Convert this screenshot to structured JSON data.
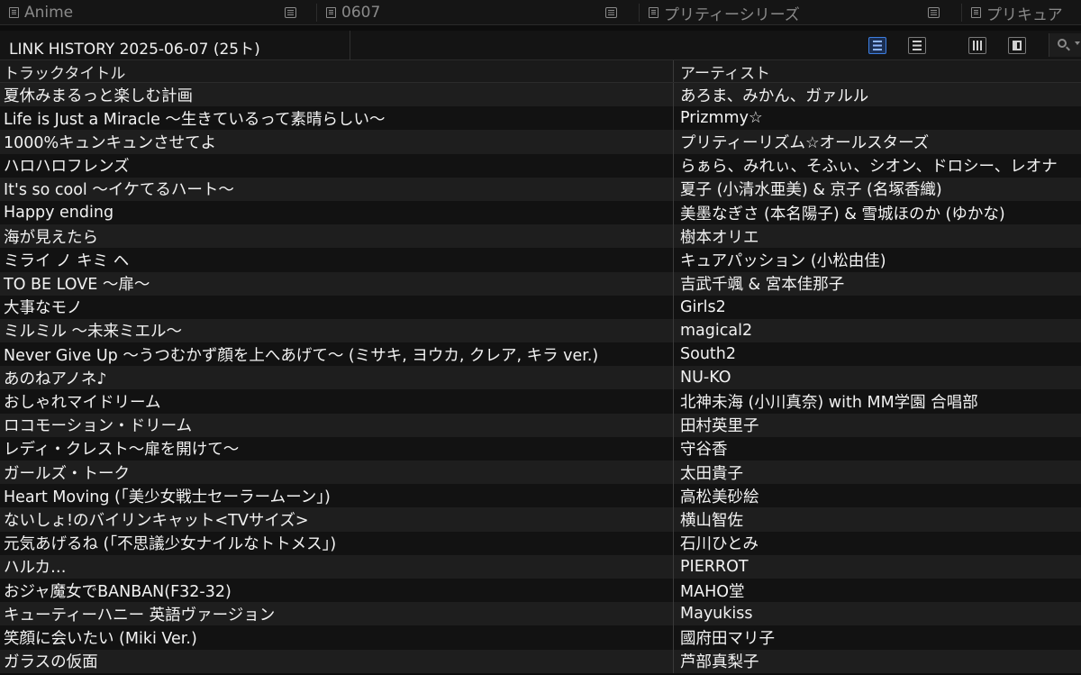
{
  "tabs": [
    {
      "label": "Anime"
    },
    {
      "label": "0607"
    },
    {
      "label": "プリティーシリーズ"
    },
    {
      "label": "プリキュア"
    }
  ],
  "playlist": {
    "title": "LINK HISTORY 2025-06-07 (25ト)"
  },
  "toolbar": {
    "view_buttons": [
      {
        "icon": "detail-list-icon",
        "active": true
      },
      {
        "icon": "compact-list-icon",
        "active": false
      },
      {
        "icon": "columns-icon",
        "active": false
      },
      {
        "icon": "panel-icon",
        "active": false
      }
    ],
    "search_icon": "search-icon"
  },
  "table": {
    "columns": [
      "トラックタイトル",
      "アーティスト"
    ],
    "rows": [
      {
        "title": "夏休みまるっと楽しむ計画",
        "artist": "あろま、みかん、ガァルル"
      },
      {
        "title": "Life is Just a Miracle 〜生きているって素晴らしい〜",
        "artist": "Prizmmy☆"
      },
      {
        "title": "1000%キュンキュンさせてよ",
        "artist": "プリティーリズム☆オールスターズ"
      },
      {
        "title": "ハロハロフレンズ",
        "artist": "らぁら、みれぃ、そふぃ、シオン、ドロシー、レオナ"
      },
      {
        "title": "It's so cool 〜イケてるハート〜",
        "artist": "夏子 (小清水亜美) & 京子 (名塚香織)"
      },
      {
        "title": "Happy ending",
        "artist": "美墨なぎさ (本名陽子) & 雪城ほのか (ゆかな)"
      },
      {
        "title": "海が見えたら",
        "artist": "樹本オリエ"
      },
      {
        "title": "ミライ ノ キミ ヘ",
        "artist": "キュアパッション (小松由佳)"
      },
      {
        "title": "TO BE LOVE 〜扉〜",
        "artist": "吉武千颯 & 宮本佳那子"
      },
      {
        "title": "大事なモノ",
        "artist": "Girls2"
      },
      {
        "title": "ミルミル 〜未来ミエル〜",
        "artist": "magical2"
      },
      {
        "title": "Never Give Up 〜うつむかず顔を上へあげて〜 (ミサキ, ヨウカ, クレア, キラ ver.)",
        "artist": "South2"
      },
      {
        "title": "あのねアノネ♪",
        "artist": "NU-KO"
      },
      {
        "title": "おしゃれマイドリーム",
        "artist": "北神未海 (小川真奈) with MM学園 合唱部"
      },
      {
        "title": "ロコモーション・ドリーム",
        "artist": "田村英里子"
      },
      {
        "title": "レディ・クレスト〜扉を開けて〜",
        "artist": "守谷香"
      },
      {
        "title": "ガールズ・トーク",
        "artist": "太田貴子"
      },
      {
        "title": "Heart Moving (「美少女戦士セーラームーン」)",
        "artist": "高松美砂絵"
      },
      {
        "title": "ないしょ!のバイリンキャット<TVサイズ>",
        "artist": "横山智佐"
      },
      {
        "title": "元気あげるね (「不思議少女ナイルなトトメス」)",
        "artist": "石川ひとみ"
      },
      {
        "title": "ハルカ…",
        "artist": "PIERROT"
      },
      {
        "title": "おジャ魔女でBANBAN(F32-32)",
        "artist": "MAHO堂"
      },
      {
        "title": "キューティーハニー 英語ヴァージョン",
        "artist": "Mayukiss"
      },
      {
        "title": "笑顔に会いたい (Miki Ver.)",
        "artist": "國府田マリ子"
      },
      {
        "title": "ガラスの仮面",
        "artist": "芦部真梨子"
      }
    ]
  }
}
